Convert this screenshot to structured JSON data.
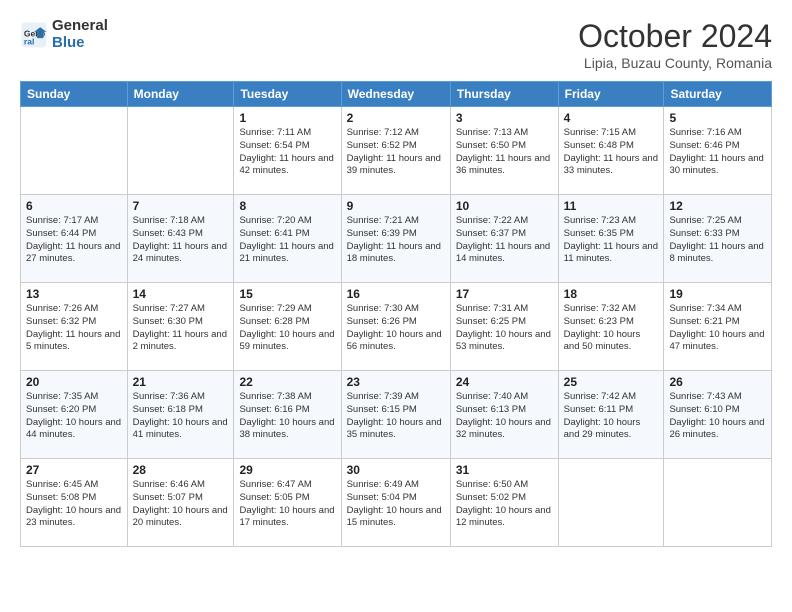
{
  "header": {
    "logo_general": "General",
    "logo_blue": "Blue",
    "month_title": "October 2024",
    "subtitle": "Lipia, Buzau County, Romania"
  },
  "weekdays": [
    "Sunday",
    "Monday",
    "Tuesday",
    "Wednesday",
    "Thursday",
    "Friday",
    "Saturday"
  ],
  "weeks": [
    [
      {
        "day": "",
        "sunrise": "",
        "sunset": "",
        "daylight": ""
      },
      {
        "day": "",
        "sunrise": "",
        "sunset": "",
        "daylight": ""
      },
      {
        "day": "1",
        "sunrise": "Sunrise: 7:11 AM",
        "sunset": "Sunset: 6:54 PM",
        "daylight": "Daylight: 11 hours and 42 minutes."
      },
      {
        "day": "2",
        "sunrise": "Sunrise: 7:12 AM",
        "sunset": "Sunset: 6:52 PM",
        "daylight": "Daylight: 11 hours and 39 minutes."
      },
      {
        "day": "3",
        "sunrise": "Sunrise: 7:13 AM",
        "sunset": "Sunset: 6:50 PM",
        "daylight": "Daylight: 11 hours and 36 minutes."
      },
      {
        "day": "4",
        "sunrise": "Sunrise: 7:15 AM",
        "sunset": "Sunset: 6:48 PM",
        "daylight": "Daylight: 11 hours and 33 minutes."
      },
      {
        "day": "5",
        "sunrise": "Sunrise: 7:16 AM",
        "sunset": "Sunset: 6:46 PM",
        "daylight": "Daylight: 11 hours and 30 minutes."
      }
    ],
    [
      {
        "day": "6",
        "sunrise": "Sunrise: 7:17 AM",
        "sunset": "Sunset: 6:44 PM",
        "daylight": "Daylight: 11 hours and 27 minutes."
      },
      {
        "day": "7",
        "sunrise": "Sunrise: 7:18 AM",
        "sunset": "Sunset: 6:43 PM",
        "daylight": "Daylight: 11 hours and 24 minutes."
      },
      {
        "day": "8",
        "sunrise": "Sunrise: 7:20 AM",
        "sunset": "Sunset: 6:41 PM",
        "daylight": "Daylight: 11 hours and 21 minutes."
      },
      {
        "day": "9",
        "sunrise": "Sunrise: 7:21 AM",
        "sunset": "Sunset: 6:39 PM",
        "daylight": "Daylight: 11 hours and 18 minutes."
      },
      {
        "day": "10",
        "sunrise": "Sunrise: 7:22 AM",
        "sunset": "Sunset: 6:37 PM",
        "daylight": "Daylight: 11 hours and 14 minutes."
      },
      {
        "day": "11",
        "sunrise": "Sunrise: 7:23 AM",
        "sunset": "Sunset: 6:35 PM",
        "daylight": "Daylight: 11 hours and 11 minutes."
      },
      {
        "day": "12",
        "sunrise": "Sunrise: 7:25 AM",
        "sunset": "Sunset: 6:33 PM",
        "daylight": "Daylight: 11 hours and 8 minutes."
      }
    ],
    [
      {
        "day": "13",
        "sunrise": "Sunrise: 7:26 AM",
        "sunset": "Sunset: 6:32 PM",
        "daylight": "Daylight: 11 hours and 5 minutes."
      },
      {
        "day": "14",
        "sunrise": "Sunrise: 7:27 AM",
        "sunset": "Sunset: 6:30 PM",
        "daylight": "Daylight: 11 hours and 2 minutes."
      },
      {
        "day": "15",
        "sunrise": "Sunrise: 7:29 AM",
        "sunset": "Sunset: 6:28 PM",
        "daylight": "Daylight: 10 hours and 59 minutes."
      },
      {
        "day": "16",
        "sunrise": "Sunrise: 7:30 AM",
        "sunset": "Sunset: 6:26 PM",
        "daylight": "Daylight: 10 hours and 56 minutes."
      },
      {
        "day": "17",
        "sunrise": "Sunrise: 7:31 AM",
        "sunset": "Sunset: 6:25 PM",
        "daylight": "Daylight: 10 hours and 53 minutes."
      },
      {
        "day": "18",
        "sunrise": "Sunrise: 7:32 AM",
        "sunset": "Sunset: 6:23 PM",
        "daylight": "Daylight: 10 hours and 50 minutes."
      },
      {
        "day": "19",
        "sunrise": "Sunrise: 7:34 AM",
        "sunset": "Sunset: 6:21 PM",
        "daylight": "Daylight: 10 hours and 47 minutes."
      }
    ],
    [
      {
        "day": "20",
        "sunrise": "Sunrise: 7:35 AM",
        "sunset": "Sunset: 6:20 PM",
        "daylight": "Daylight: 10 hours and 44 minutes."
      },
      {
        "day": "21",
        "sunrise": "Sunrise: 7:36 AM",
        "sunset": "Sunset: 6:18 PM",
        "daylight": "Daylight: 10 hours and 41 minutes."
      },
      {
        "day": "22",
        "sunrise": "Sunrise: 7:38 AM",
        "sunset": "Sunset: 6:16 PM",
        "daylight": "Daylight: 10 hours and 38 minutes."
      },
      {
        "day": "23",
        "sunrise": "Sunrise: 7:39 AM",
        "sunset": "Sunset: 6:15 PM",
        "daylight": "Daylight: 10 hours and 35 minutes."
      },
      {
        "day": "24",
        "sunrise": "Sunrise: 7:40 AM",
        "sunset": "Sunset: 6:13 PM",
        "daylight": "Daylight: 10 hours and 32 minutes."
      },
      {
        "day": "25",
        "sunrise": "Sunrise: 7:42 AM",
        "sunset": "Sunset: 6:11 PM",
        "daylight": "Daylight: 10 hours and 29 minutes."
      },
      {
        "day": "26",
        "sunrise": "Sunrise: 7:43 AM",
        "sunset": "Sunset: 6:10 PM",
        "daylight": "Daylight: 10 hours and 26 minutes."
      }
    ],
    [
      {
        "day": "27",
        "sunrise": "Sunrise: 6:45 AM",
        "sunset": "Sunset: 5:08 PM",
        "daylight": "Daylight: 10 hours and 23 minutes."
      },
      {
        "day": "28",
        "sunrise": "Sunrise: 6:46 AM",
        "sunset": "Sunset: 5:07 PM",
        "daylight": "Daylight: 10 hours and 20 minutes."
      },
      {
        "day": "29",
        "sunrise": "Sunrise: 6:47 AM",
        "sunset": "Sunset: 5:05 PM",
        "daylight": "Daylight: 10 hours and 17 minutes."
      },
      {
        "day": "30",
        "sunrise": "Sunrise: 6:49 AM",
        "sunset": "Sunset: 5:04 PM",
        "daylight": "Daylight: 10 hours and 15 minutes."
      },
      {
        "day": "31",
        "sunrise": "Sunrise: 6:50 AM",
        "sunset": "Sunset: 5:02 PM",
        "daylight": "Daylight: 10 hours and 12 minutes."
      },
      {
        "day": "",
        "sunrise": "",
        "sunset": "",
        "daylight": ""
      },
      {
        "day": "",
        "sunrise": "",
        "sunset": "",
        "daylight": ""
      }
    ]
  ]
}
